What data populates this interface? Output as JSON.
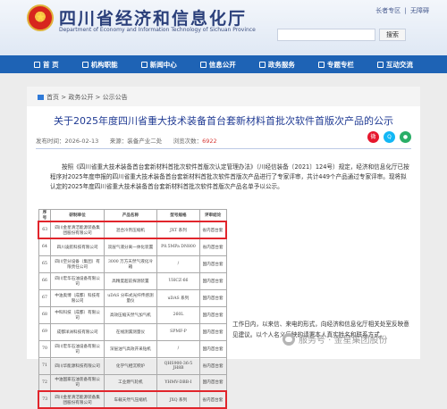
{
  "header": {
    "site_title": "四川省经济和信息化厅",
    "site_subtitle": "Department of Economy and Information Technology of Sichuan Province",
    "top_links": [
      "长者专区",
      "|",
      "无障碍"
    ],
    "search_button": "搜索"
  },
  "nav": {
    "items": [
      {
        "label": "首 页",
        "icon": "home-icon"
      },
      {
        "label": "机构职能",
        "icon": "building-icon"
      },
      {
        "label": "新闻中心",
        "icon": "news-icon"
      },
      {
        "label": "信息公开",
        "icon": "document-icon"
      },
      {
        "label": "政务服务",
        "icon": "service-icon"
      },
      {
        "label": "专题专栏",
        "icon": "topic-icon"
      },
      {
        "label": "互动交流",
        "icon": "chat-icon"
      }
    ]
  },
  "breadcrumb": {
    "text": "首页 > 政务公开 > 公示公告"
  },
  "article": {
    "title": "关于2025年度四川省重大技术装备首台套新材料首批次软件首版次产品的公示",
    "date": "发布时间：2026-02-13",
    "source": "来源：装备产业二处",
    "views_label": "浏览次数：",
    "views": "6922",
    "body_p1": "按照《四川省重大技术装备首台套新材料首批次软件首版次认定管理办法》（川经信装备〔2021〕124号）规定，经济和信息化厅已按程序对2025年度申报的四川省重大技术装备首台套新材料首批次软件首版次产品进行了专家评审，共计449个产品通过专家评审。现将拟认定的2025年度四川省重大技术装备首台套新材料首批次软件首版次产品名单予以公示。",
    "right_text": "工作日内，以来信、来电的形式，向经济和信息化厅相关处室反映意见建议。以个人名义反映的请署本人真实姓名和联系方式。"
  },
  "table": {
    "headers": [
      "序号",
      "研制单位",
      "产品名称",
      "型号规格",
      "评审结论"
    ],
    "rows": [
      {
        "no": "63",
        "unit": "四川金星清洁能源装备集团股份有限公司",
        "product": "混合冷剂压缩机",
        "model": "JXT 系列",
        "type": "省内首台套",
        "highlight": true
      },
      {
        "no": "64",
        "unit": "四川凌航科技有限公司",
        "product": "双层气液分离一体化装置",
        "model": "P8.5MPa DN800",
        "type": "省内首台套",
        "highlight": false
      },
      {
        "no": "65",
        "unit": "四川空分设备（集团）有限责任公司",
        "product": "3000 万方天然气液化冷箱",
        "model": "/",
        "type": "国内首台套",
        "highlight": false
      },
      {
        "no": "66",
        "unit": "四川宏华石油设备有限公司",
        "product": "高精度超前探测装置",
        "model": "UHCZ-66",
        "type": "国内首台套",
        "highlight": false
      },
      {
        "no": "67",
        "unit": "中油奥博（成都）科技有限公司",
        "product": "uDAS 分布式光纤传感测量仪",
        "model": "uDAS 系列",
        "type": "国内首台套",
        "highlight": false
      },
      {
        "no": "68",
        "unit": "中科科技（成都）有限公司",
        "product": "高效压缩天然气加气机",
        "model": "260L",
        "type": "国内首台套",
        "highlight": false
      },
      {
        "no": "69",
        "unit": "成都洋洲科技有限公司",
        "product": "在线测漏测量仪",
        "model": "SPMF-P",
        "type": "国内首台套",
        "highlight": false
      },
      {
        "no": "70",
        "unit": "四川宏华石油设备有限公司",
        "product": "深层油气高效开采钻机",
        "model": "/",
        "type": "国内首台套",
        "highlight": false
      },
      {
        "no": "71",
        "unit": "四川华能源科技有限公司",
        "product": "化学气相沉积炉",
        "model": "QHS900-36-5 JH8B",
        "type": "省内首台套",
        "highlight": false
      },
      {
        "no": "72",
        "unit": "中油国家石油装备有限公司",
        "product": "工业燃气轮机",
        "model": "YHMV-DBB-I",
        "type": "国内首台套",
        "highlight": false
      },
      {
        "no": "73",
        "unit": "四川金星清洁能源装备集团股份有限公司",
        "product": "车载天然气压缩机",
        "model": "JXQ 系列",
        "type": "省内首台套",
        "highlight": true
      }
    ]
  },
  "share": [
    {
      "icon": "weibo-icon",
      "color": "#e6162d"
    },
    {
      "icon": "qq-icon",
      "color": "#12b7f5"
    },
    {
      "icon": "wechat-icon",
      "color": "#2aae67"
    }
  ],
  "watermark": {
    "text": "服务号 · 金星集团股份"
  },
  "colors": {
    "brand_blue": "#1e63b5",
    "title_blue": "#1f3a93",
    "highlight_red": "#e1252c"
  }
}
